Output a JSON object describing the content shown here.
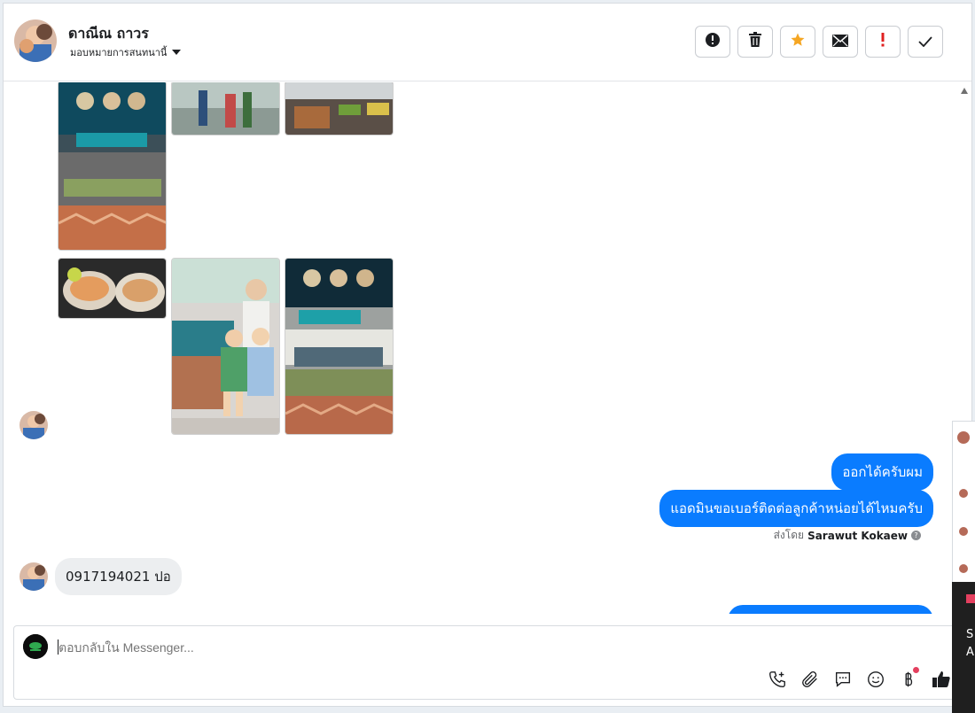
{
  "header": {
    "name": "ดาณีณ ถาวร",
    "assign_label": "มอบหมายการสนทนานี้"
  },
  "toolbar": {
    "buttons": [
      "alert-icon",
      "trash-icon",
      "star-icon",
      "envelope-icon",
      "exclamation-icon",
      "check-icon"
    ],
    "star_color": "#f5a623",
    "exclamation_color": "#e02020"
  },
  "messages": {
    "out1": "ออกได้ครับผม",
    "out2": "แอดมินขอเบอร์ติดต่อลูกค้าหน่อยได้ไหมครับ",
    "sent_by_prefix": "ส่งโดย",
    "sent_by_name": "Sarawut Kokaew",
    "in1": "0917194021 ปอ"
  },
  "composer": {
    "placeholder": "ตอบกลับใน Messenger...",
    "icons": [
      "phone-plus-icon",
      "paperclip-icon",
      "chat-bubble-icon",
      "emoji-icon",
      "baht-icon",
      "thumbs-up-icon"
    ]
  },
  "side_panel": {
    "text_lines": [
      "S",
      "A"
    ]
  },
  "colors": {
    "accent": "#0a7cff",
    "incoming_bubble": "#eceef0"
  }
}
